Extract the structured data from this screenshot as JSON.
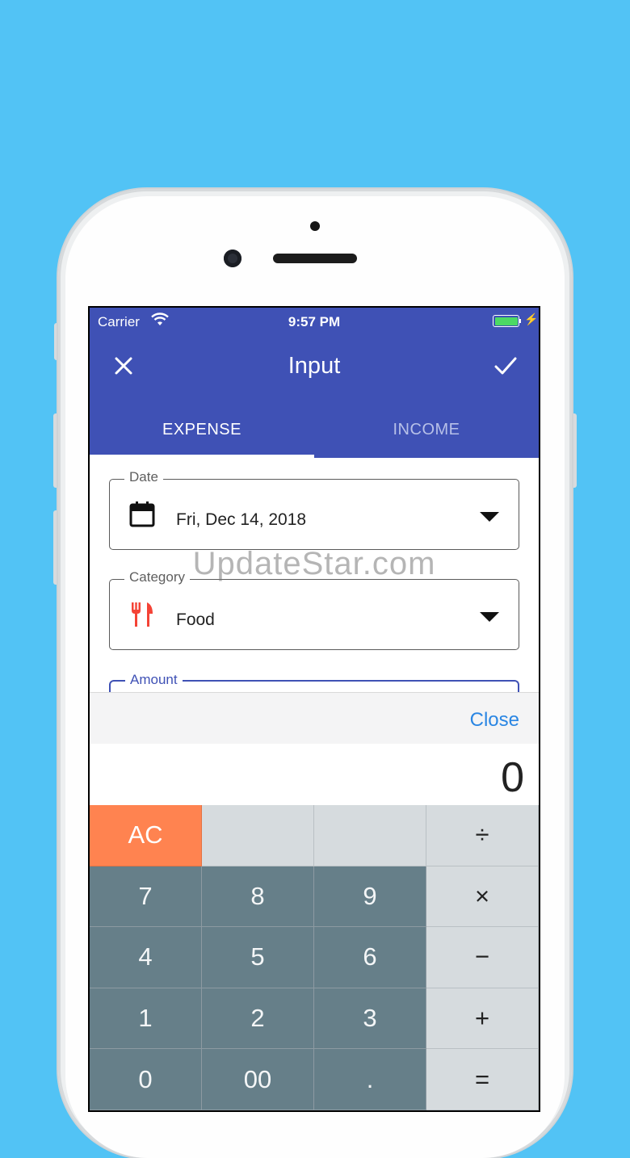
{
  "status": {
    "carrier": "Carrier",
    "time": "9:57 PM"
  },
  "toolbar": {
    "title": "Input"
  },
  "tabs": [
    {
      "label": "EXPENSE"
    },
    {
      "label": "INCOME"
    }
  ],
  "date_field": {
    "label": "Date",
    "value": "Fri, Dec 14, 2018"
  },
  "category_field": {
    "label": "Category",
    "value": "Food"
  },
  "amount_field": {
    "label": "Amount"
  },
  "watermark": "UpdateStar.com",
  "keyboard": {
    "close_label": "Close",
    "display": "0"
  },
  "keys": {
    "ac": "AC",
    "divide": "÷",
    "multiply": "×",
    "minus": "−",
    "plus": "+",
    "equals": "=",
    "k7": "7",
    "k8": "8",
    "k9": "9",
    "k4": "4",
    "k5": "5",
    "k6": "6",
    "k1": "1",
    "k2": "2",
    "k3": "3",
    "k0": "0",
    "k00": "00",
    "dot": "."
  },
  "colors": {
    "background": "#52c3f5",
    "appbar": "#3f51b5",
    "ac": "#ff8350",
    "number_key": "#667f89",
    "operator_key": "#d6dbde",
    "close": "#2a86e3",
    "category_icon": "#f44336"
  },
  "icons": {
    "close": "close-icon",
    "check": "check-icon",
    "calendar": "calendar-icon",
    "category": "restaurant-icon",
    "wifi": "wifi-icon",
    "battery": "battery-icon"
  }
}
